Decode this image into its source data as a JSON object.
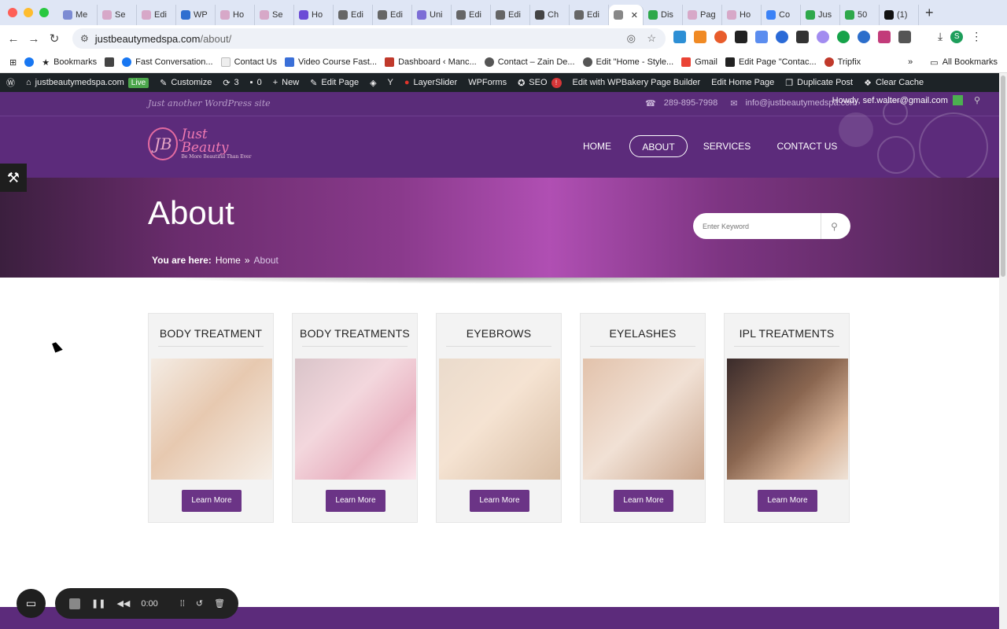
{
  "browser": {
    "tabs": [
      "Me",
      "Se",
      "Edi",
      "WP",
      "Ho",
      "Se",
      "Ho",
      "Edi",
      "Edi",
      "Uni",
      "Edi",
      "Edi",
      "Ch",
      "Edi",
      "",
      "Dis",
      "Pag",
      "Ho",
      "Co",
      "Jus",
      "50",
      "(1)"
    ],
    "url_domain": "justbeautymedspa.com",
    "url_path": "/about/",
    "bookmarks": [
      "Bookmarks",
      "Fast Conversation...",
      "Contact Us",
      "Video Course Fast...",
      "Dashboard ‹ Manc...",
      "Contact – Zain De...",
      "Edit \"Home - Style...",
      "Gmail",
      "Edit Page \"Contac...",
      "Tripfix"
    ],
    "all_bookmarks": "All Bookmarks"
  },
  "wpbar": {
    "site": "justbeautymedspa.com",
    "live": "Live",
    "customize": "Customize",
    "updates": "3",
    "comments": "0",
    "new": "New",
    "edit_page": "Edit Page",
    "layerslider": "LayerSlider",
    "wpforms": "WPForms",
    "seo": "SEO",
    "wpbakery": "Edit with WPBakery Page Builder",
    "edit_home": "Edit Home Page",
    "duplicate": "Duplicate Post",
    "clear_cache": "Clear Cache",
    "howdy": "Howdy, sef.walter@gmail.com"
  },
  "site": {
    "tagline": "Just another WordPress site",
    "phone": "289-895-7998",
    "email": "info@justbeautymedspa.com",
    "logo_text": "Just Beauty",
    "logo_sub": "Be More Beautiful Than Ever",
    "menu": [
      "HOME",
      "ABOUT",
      "SERVICES",
      "CONTACT US"
    ],
    "hero_title": "About",
    "search_placeholder": "Enter Keyword",
    "crumb_label": "You are here:",
    "crumb_home": "Home",
    "crumb_current": "About",
    "cards": [
      {
        "title": "BODY TREATMENT",
        "button": "Learn More"
      },
      {
        "title": "BODY TREATMENTS",
        "button": "Learn More"
      },
      {
        "title": "EYEBROWS",
        "button": "Learn More"
      },
      {
        "title": "EYELASHES",
        "button": "Learn More"
      },
      {
        "title": "IPL TREATMENTS",
        "button": "Learn More"
      }
    ]
  },
  "recorder": {
    "time": "0:00"
  },
  "colors": {
    "brand_purple": "#5c2b7b",
    "button_purple": "#6b3486"
  }
}
